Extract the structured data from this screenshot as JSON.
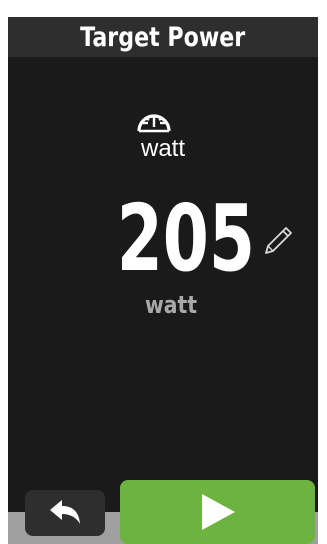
{
  "header": {
    "title": "Target Power"
  },
  "main": {
    "icon_name": "power-gauge-icon",
    "icon_unit_label": "watt",
    "value": "205",
    "unit_label": "watt",
    "edit_icon_name": "pencil-icon"
  },
  "footer": {
    "back_icon_name": "back-arrow-icon",
    "start_icon_name": "play-icon"
  },
  "colors": {
    "panel_background": "#1a1a1a",
    "header_background": "#2e2e2e",
    "value_text": "#ffffff",
    "unit_text": "#a9a9a9",
    "start_button": "#6cb33f",
    "back_button": "#2e2e2e",
    "footer_strip": "#a0a0a0"
  }
}
